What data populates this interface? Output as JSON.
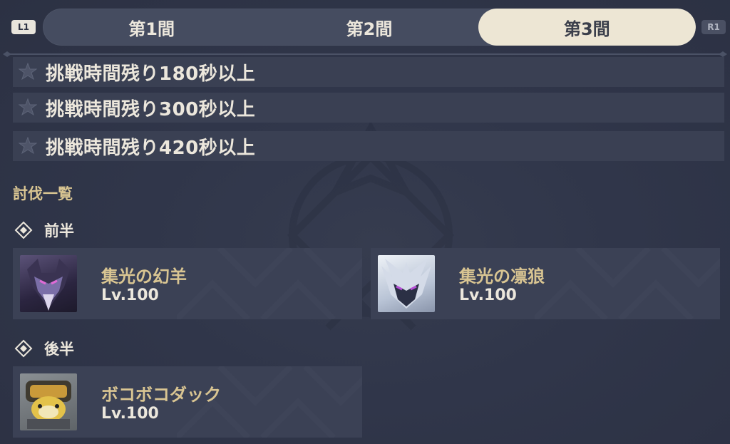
{
  "controls": {
    "prev_key": "L1",
    "next_key": "R1"
  },
  "tabs": [
    {
      "label": "第1間",
      "active": false
    },
    {
      "label": "第2間",
      "active": false
    },
    {
      "label": "第3間",
      "active": true
    }
  ],
  "conditions": [
    {
      "icon": "star-icon",
      "text": "挑戦時間残り180秒以上"
    },
    {
      "icon": "star-icon",
      "text": "挑戦時間残り300秒以上"
    },
    {
      "icon": "star-icon",
      "text": "挑戦時間残り420秒以上"
    }
  ],
  "enemy_list": {
    "title": "討伐一覧",
    "first_half": {
      "label": "前半",
      "enemies": [
        {
          "name": "集光の幻羊",
          "level": "Lv.100"
        },
        {
          "name": "集光の凛狼",
          "level": "Lv.100"
        }
      ]
    },
    "second_half": {
      "label": "後半",
      "enemies": [
        {
          "name": "ボコボコダック",
          "level": "Lv.100"
        }
      ]
    }
  },
  "colors": {
    "background": "#2f3445",
    "panel": "#3a4053",
    "tab_active": "#ede6d4",
    "gold_text": "#d9c592",
    "light_text": "#ece7dc"
  }
}
